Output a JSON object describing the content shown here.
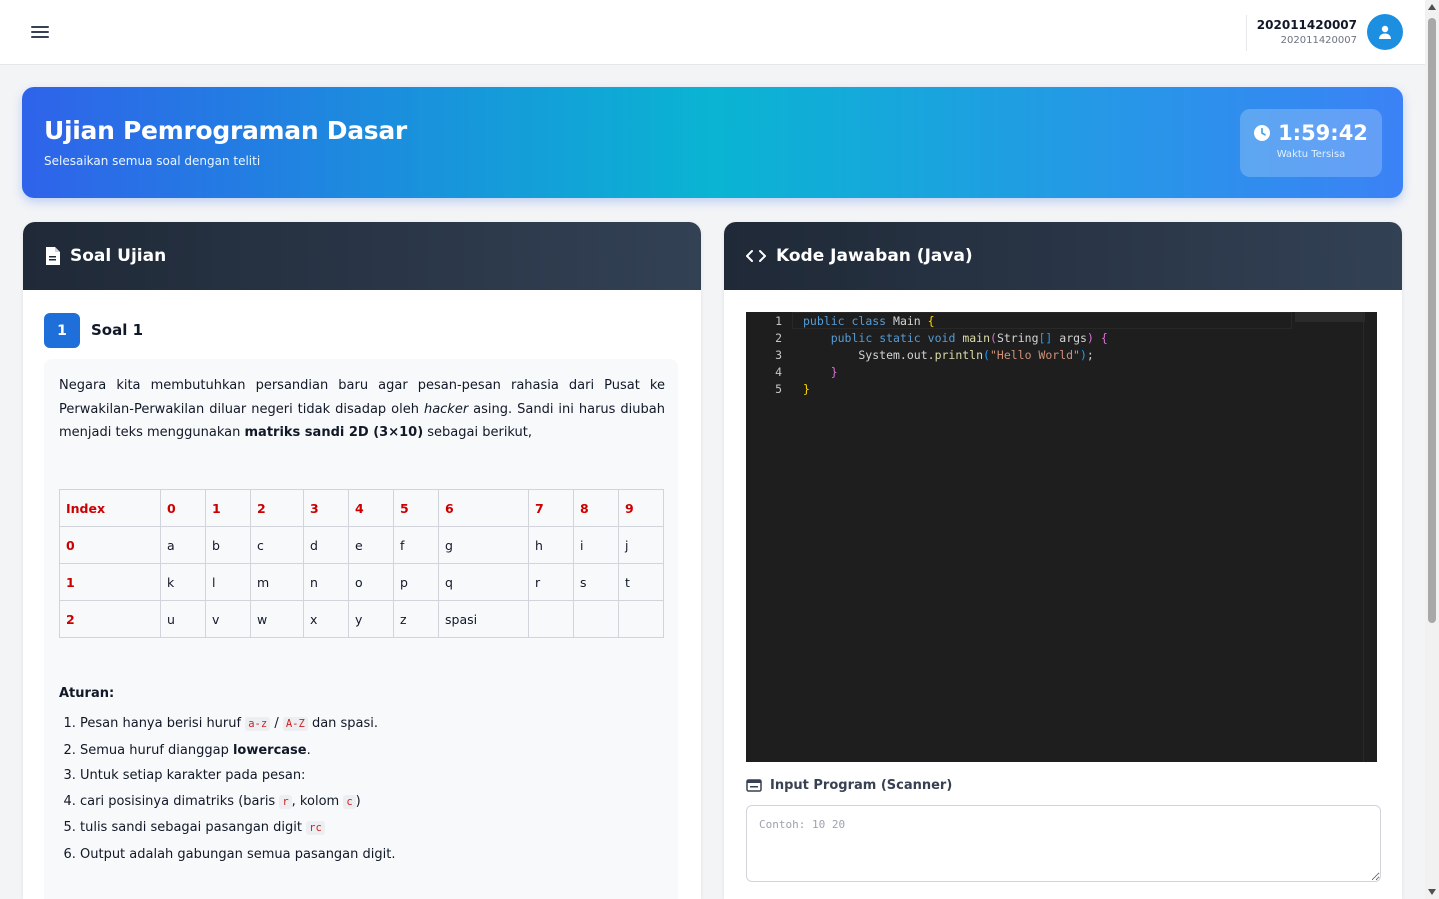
{
  "header": {
    "user_name": "202011420007",
    "user_id": "202011420007",
    "menu_icon": "hamburger-icon",
    "avatar_icon": "user-icon"
  },
  "hero": {
    "title": "Ujian Pemrograman Dasar",
    "subtitle": "Selesaikan semua soal dengan teliti",
    "timer_value": "1:59:42",
    "timer_label": "Waktu Tersisa"
  },
  "question_panel": {
    "title": "Soal Ujian",
    "number": "1",
    "label": "Soal 1",
    "para_1": "Negara kita membutuhkan persandian baru agar pesan-pesan rahasia dari Pusat ke Perwakilan-Perwakilan diluar negeri tidak disadap oleh ",
    "para_italic": "hacker",
    "para_2": " asing. Sandi ini harus diubah menjadi teks menggunakan ",
    "para_bold": "matriks sandi 2D (3×10)",
    "para_3": " sebagai berikut,",
    "table": {
      "header": [
        "Index",
        "0",
        "1",
        "2",
        "3",
        "4",
        "5",
        "6",
        "7",
        "8",
        "9"
      ],
      "rows": [
        [
          "0",
          "a",
          "b",
          "c",
          "d",
          "e",
          "f",
          "g",
          "h",
          "i",
          "j"
        ],
        [
          "1",
          "k",
          "l",
          "m",
          "n",
          "o",
          "p",
          "q",
          "r",
          "s",
          "t"
        ],
        [
          "2",
          "u",
          "v",
          "w",
          "x",
          "y",
          "z",
          "spasi",
          "",
          "",
          ""
        ]
      ]
    },
    "rules_title": "Aturan:",
    "rules": {
      "r1_a": "Pesan hanya berisi huruf ",
      "r1_code1": "a-z",
      "r1_sep": " / ",
      "r1_code2": "A-Z",
      "r1_b": " dan spasi.",
      "r2_a": "Semua huruf dianggap ",
      "r2_bold": "lowercase",
      "r2_b": ".",
      "r3": "Untuk setiap karakter pada pesan:",
      "r4_a": "cari posisinya dimatriks (baris ",
      "r4_code1": "r",
      "r4_b": ", kolom ",
      "r4_code2": "c",
      "r4_c": ")",
      "r5_a": "tulis sandi sebagai pasangan digit ",
      "r5_code": "rc",
      "r6": "Output adalah gabungan semua pasangan digit."
    }
  },
  "code_panel": {
    "title": "Kode Jawaban (Java)",
    "line_numbers": [
      "1",
      "2",
      "3",
      "4",
      "5"
    ],
    "input_label": "Input Program (Scanner)",
    "input_placeholder": "Contoh: 10 20",
    "input_value": ""
  },
  "colors": {
    "accent": "#1e6fd9",
    "hero_start": "#2f63ea",
    "hero_mid": "#0ab4d2",
    "card_header": "#1f2937",
    "table_header_text": "#cc0000",
    "editor_bg": "#1e1e1e"
  }
}
